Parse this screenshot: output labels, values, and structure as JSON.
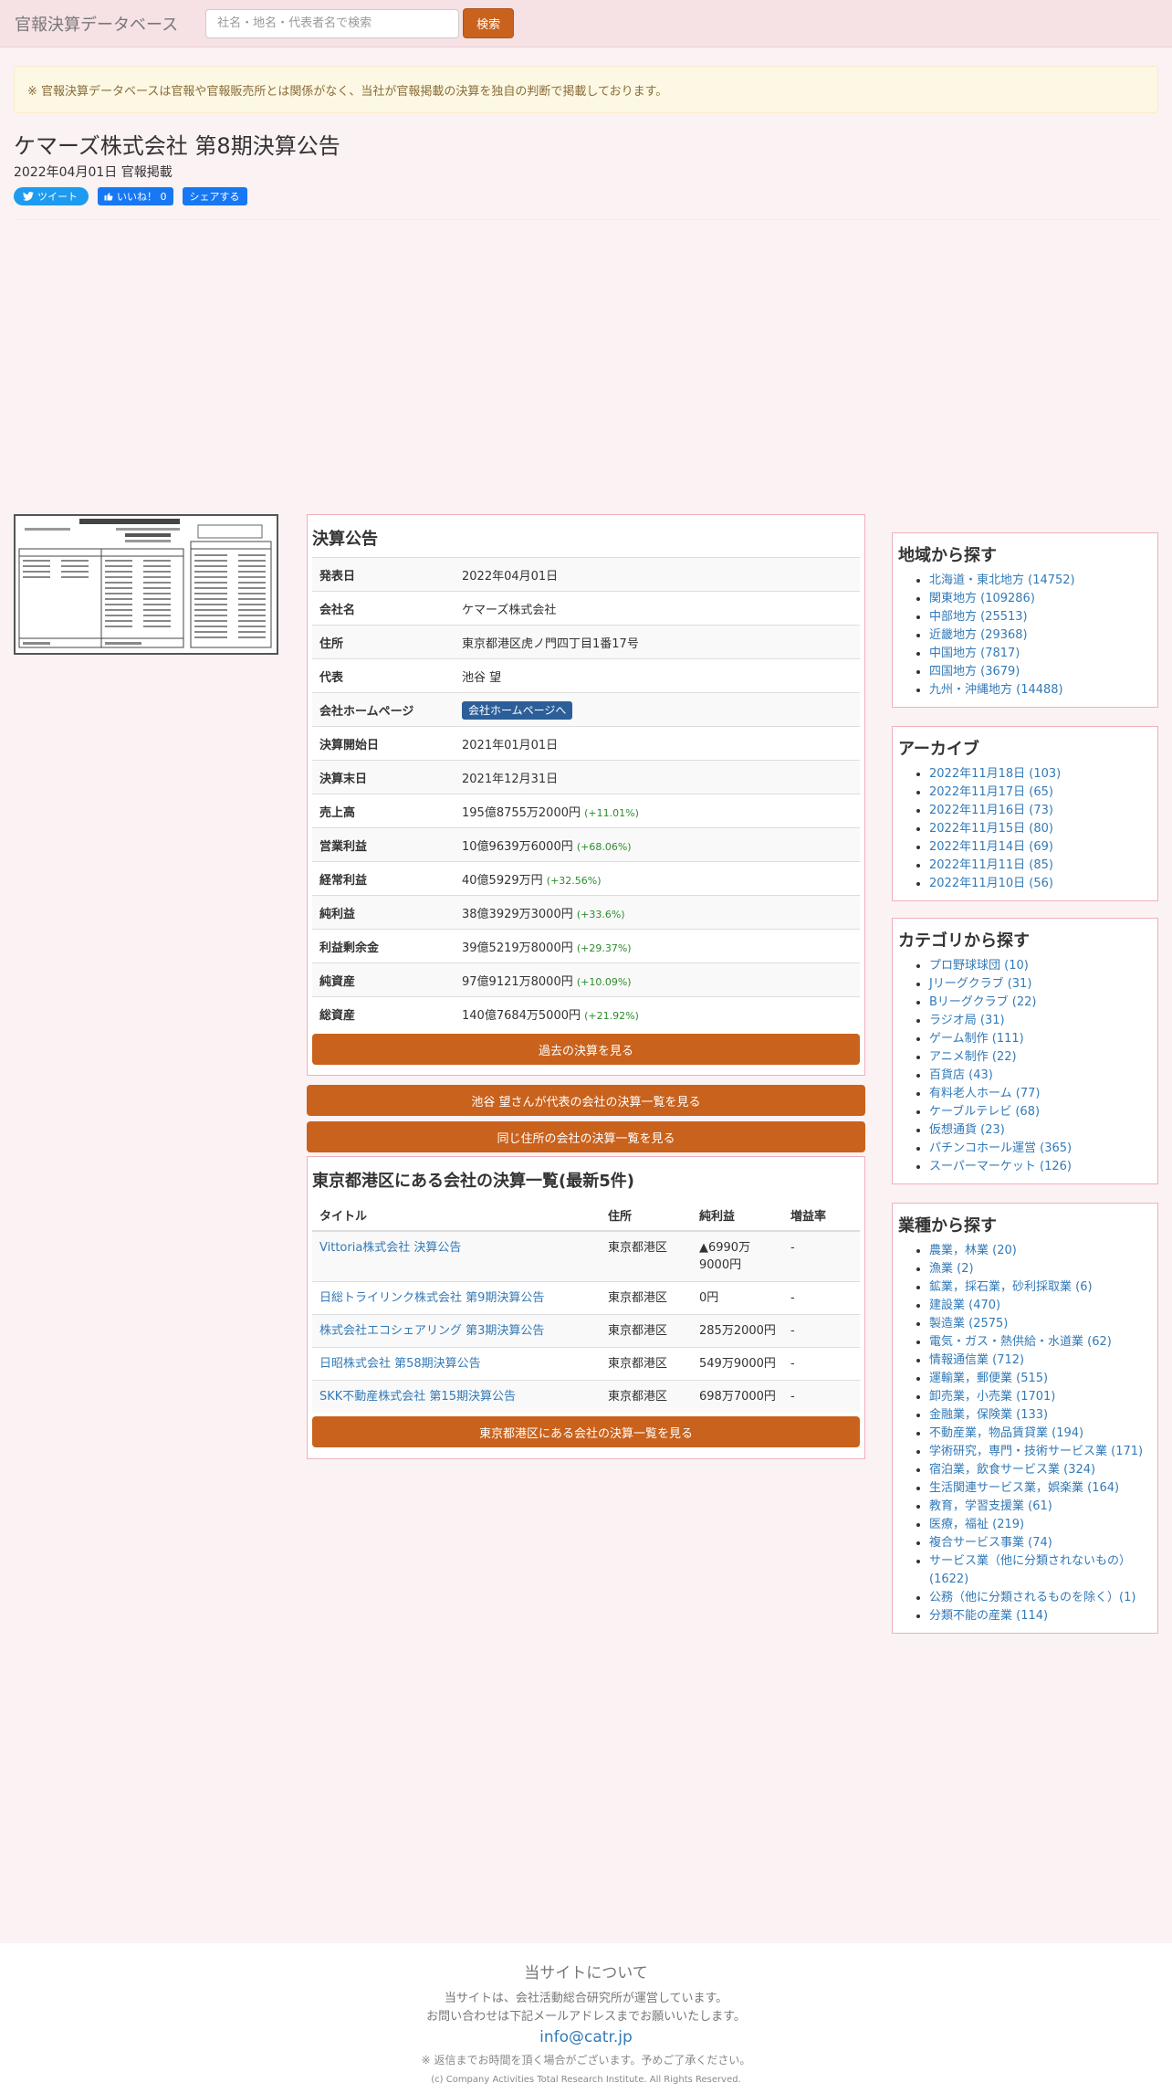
{
  "header": {
    "brand": "官報決算データベース",
    "search_placeholder": "社名・地名・代表者名で検索",
    "search_button": "検索"
  },
  "notice": "※ 官報決算データベースは官報や官報販売所とは関係がなく、当社が官報掲載の決算を独自の判断で掲載しております。",
  "title": "ケマーズ株式会社 第8期決算公告",
  "publish_date": "2022年04月01日 官報掲載",
  "social": {
    "tweet": "ツイート",
    "like": "いいね！ 0",
    "share": "シェアする"
  },
  "financials": {
    "heading": "決算公告",
    "rows": [
      {
        "label": "発表日",
        "value": "2022年04月01日",
        "change": ""
      },
      {
        "label": "会社名",
        "value": "ケマーズ株式会社",
        "change": ""
      },
      {
        "label": "住所",
        "value": "東京都港区虎ノ門四丁目1番17号",
        "change": ""
      },
      {
        "label": "代表",
        "value": "池谷 望",
        "change": ""
      },
      {
        "label": "会社ホームページ",
        "value": "会社ホームページへ",
        "change": ""
      },
      {
        "label": "決算開始日",
        "value": "2021年01月01日",
        "change": ""
      },
      {
        "label": "決算末日",
        "value": "2021年12月31日",
        "change": ""
      },
      {
        "label": "売上高",
        "value": "195億8755万2000円",
        "change": "(+11.01%)"
      },
      {
        "label": "営業利益",
        "value": "10億9639万6000円",
        "change": "(+68.06%)"
      },
      {
        "label": "経常利益",
        "value": "40億5929万円",
        "change": "(+32.56%)"
      },
      {
        "label": "純利益",
        "value": "38億3929万3000円",
        "change": "(+33.6%)"
      },
      {
        "label": "利益剰余金",
        "value": "39億5219万8000円",
        "change": "(+29.37%)"
      },
      {
        "label": "純資産",
        "value": "97億9121万8000円",
        "change": "(+10.09%)"
      },
      {
        "label": "総資産",
        "value": "140億7684万5000円",
        "change": "(+21.92%)"
      }
    ],
    "past_button": "過去の決算を見る"
  },
  "rep_button": "池谷 望さんが代表の会社の決算一覧を見る",
  "address_button": "同じ住所の会社の決算一覧を見る",
  "area_list": {
    "heading": "東京都港区にある会社の決算一覧(最新5件)",
    "columns": [
      "タイトル",
      "住所",
      "純利益",
      "増益率"
    ],
    "rows": [
      {
        "title": "Vittoria株式会社 決算公告",
        "address": "東京都港区",
        "profit": "▲6990万9000円",
        "rate": "-"
      },
      {
        "title": "日総トライリンク株式会社 第9期決算公告",
        "address": "東京都港区",
        "profit": "0円",
        "rate": "-"
      },
      {
        "title": "株式会社エコシェアリング 第3期決算公告",
        "address": "東京都港区",
        "profit": "285万2000円",
        "rate": "-"
      },
      {
        "title": "日昭株式会社 第58期決算公告",
        "address": "東京都港区",
        "profit": "549万9000円",
        "rate": "-"
      },
      {
        "title": "SKK不動産株式会社 第15期決算公告",
        "address": "東京都港区",
        "profit": "698万7000円",
        "rate": "-"
      }
    ],
    "more_button": "東京都港区にある会社の決算一覧を見る"
  },
  "sidebar": {
    "region": {
      "heading": "地域から探す",
      "items": [
        "北海道・東北地方 (14752)",
        "関東地方 (109286)",
        "中部地方 (25513)",
        "近畿地方 (29368)",
        "中国地方 (7817)",
        "四国地方 (3679)",
        "九州・沖縄地方 (14488)"
      ]
    },
    "archive": {
      "heading": "アーカイブ",
      "items": [
        "2022年11月18日 (103)",
        "2022年11月17日 (65)",
        "2022年11月16日 (73)",
        "2022年11月15日 (80)",
        "2022年11月14日 (69)",
        "2022年11月11日 (85)",
        "2022年11月10日 (56)"
      ]
    },
    "category": {
      "heading": "カテゴリから探す",
      "items": [
        "プロ野球球団 (10)",
        "Jリーグクラブ (31)",
        "Bリーグクラブ (22)",
        "ラジオ局 (31)",
        "ゲーム制作 (111)",
        "アニメ制作 (22)",
        "百貨店 (43)",
        "有料老人ホーム (77)",
        "ケーブルテレビ (68)",
        "仮想通貨 (23)",
        "パチンコホール運営 (365)",
        "スーパーマーケット (126)"
      ]
    },
    "industry": {
      "heading": "業種から探す",
      "items": [
        "農業，林業 (20)",
        "漁業 (2)",
        "鉱業，採石業，砂利採取業 (6)",
        "建設業 (470)",
        "製造業 (2575)",
        "電気・ガス・熱供給・水道業 (62)",
        "情報通信業 (712)",
        "運輸業，郵便業 (515)",
        "卸売業，小売業 (1701)",
        "金融業，保険業 (133)",
        "不動産業，物品賃貸業 (194)",
        "学術研究，専門・技術サービス業 (171)",
        "宿泊業，飲食サービス業 (324)",
        "生活関連サービス業，娯楽業 (164)",
        "教育，学習支援業 (61)",
        "医療，福祉 (219)",
        "複合サービス事業 (74)",
        "サービス業（他に分類されないもの）(1622)",
        "公務（他に分類されるものを除く）(1)",
        "分類不能の産業 (114)"
      ]
    }
  },
  "footer": {
    "title": "当サイトについて",
    "line1": "当サイトは、会社活動総合研究所が運営しています。",
    "line2": "お問い合わせは下記メールアドレスまでお願いいたします。",
    "email": "info@catr.jp",
    "note": "※ 返信までお時間を頂く場合がございます。予めご了承ください。",
    "copyright": "(c) Company Activities Total Research Institute. All Rights Reserved."
  }
}
